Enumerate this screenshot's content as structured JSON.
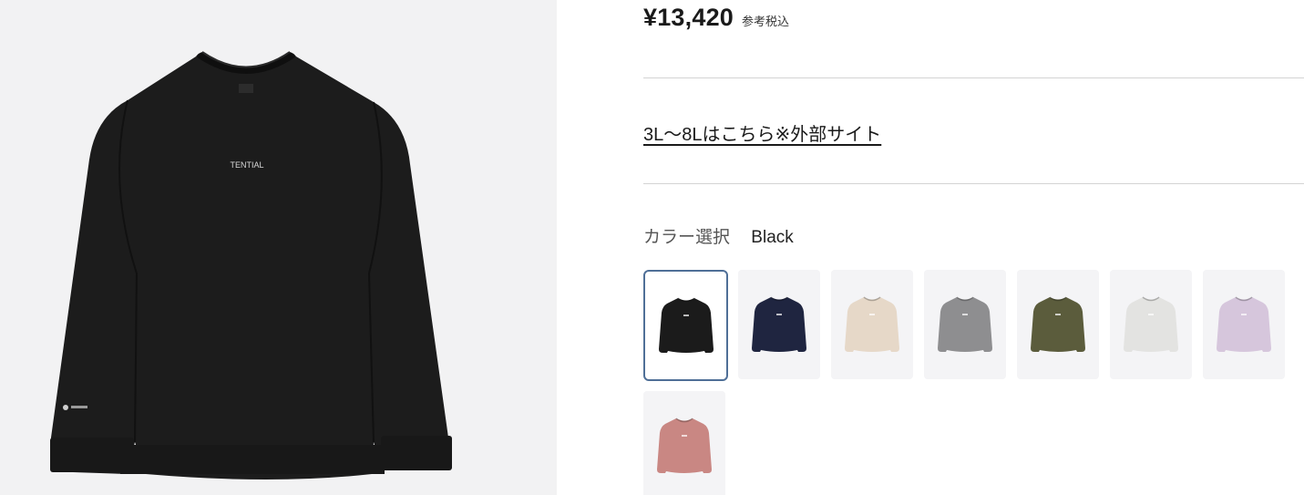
{
  "product": {
    "price": "¥13,420",
    "tax_note": "参考税込",
    "external_size_link": "3L〜8Lはこちら※外部サイト",
    "image_logo_text": "TENTIAL"
  },
  "color_selector": {
    "label": "カラー選択",
    "selected_value": "Black",
    "options": [
      {
        "name": "Black",
        "color": "#1b1b1b",
        "selected": true
      },
      {
        "name": "Navy",
        "color": "#1f2540",
        "selected": false
      },
      {
        "name": "Beige",
        "color": "#e6d8c8",
        "selected": false
      },
      {
        "name": "Gray",
        "color": "#8e8e90",
        "selected": false
      },
      {
        "name": "Olive",
        "color": "#5b5c3c",
        "selected": false
      },
      {
        "name": "Light Gray",
        "color": "#e3e3e1",
        "selected": false
      },
      {
        "name": "Lavender",
        "color": "#d6c6dc",
        "selected": false
      },
      {
        "name": "Pink",
        "color": "#c98783",
        "selected": false
      }
    ]
  }
}
